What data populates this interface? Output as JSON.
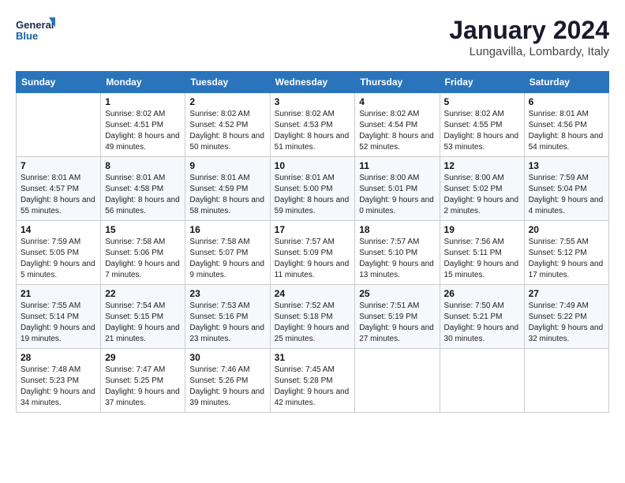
{
  "logo": {
    "line1": "General",
    "line2": "Blue"
  },
  "title": "January 2024",
  "subtitle": "Lungavilla, Lombardy, Italy",
  "days_header": [
    "Sunday",
    "Monday",
    "Tuesday",
    "Wednesday",
    "Thursday",
    "Friday",
    "Saturday"
  ],
  "weeks": [
    [
      {
        "num": "",
        "sunrise": "",
        "sunset": "",
        "daylight": ""
      },
      {
        "num": "1",
        "sunrise": "Sunrise: 8:02 AM",
        "sunset": "Sunset: 4:51 PM",
        "daylight": "Daylight: 8 hours and 49 minutes."
      },
      {
        "num": "2",
        "sunrise": "Sunrise: 8:02 AM",
        "sunset": "Sunset: 4:52 PM",
        "daylight": "Daylight: 8 hours and 50 minutes."
      },
      {
        "num": "3",
        "sunrise": "Sunrise: 8:02 AM",
        "sunset": "Sunset: 4:53 PM",
        "daylight": "Daylight: 8 hours and 51 minutes."
      },
      {
        "num": "4",
        "sunrise": "Sunrise: 8:02 AM",
        "sunset": "Sunset: 4:54 PM",
        "daylight": "Daylight: 8 hours and 52 minutes."
      },
      {
        "num": "5",
        "sunrise": "Sunrise: 8:02 AM",
        "sunset": "Sunset: 4:55 PM",
        "daylight": "Daylight: 8 hours and 53 minutes."
      },
      {
        "num": "6",
        "sunrise": "Sunrise: 8:01 AM",
        "sunset": "Sunset: 4:56 PM",
        "daylight": "Daylight: 8 hours and 54 minutes."
      }
    ],
    [
      {
        "num": "7",
        "sunrise": "Sunrise: 8:01 AM",
        "sunset": "Sunset: 4:57 PM",
        "daylight": "Daylight: 8 hours and 55 minutes."
      },
      {
        "num": "8",
        "sunrise": "Sunrise: 8:01 AM",
        "sunset": "Sunset: 4:58 PM",
        "daylight": "Daylight: 8 hours and 56 minutes."
      },
      {
        "num": "9",
        "sunrise": "Sunrise: 8:01 AM",
        "sunset": "Sunset: 4:59 PM",
        "daylight": "Daylight: 8 hours and 58 minutes."
      },
      {
        "num": "10",
        "sunrise": "Sunrise: 8:01 AM",
        "sunset": "Sunset: 5:00 PM",
        "daylight": "Daylight: 8 hours and 59 minutes."
      },
      {
        "num": "11",
        "sunrise": "Sunrise: 8:00 AM",
        "sunset": "Sunset: 5:01 PM",
        "daylight": "Daylight: 9 hours and 0 minutes."
      },
      {
        "num": "12",
        "sunrise": "Sunrise: 8:00 AM",
        "sunset": "Sunset: 5:02 PM",
        "daylight": "Daylight: 9 hours and 2 minutes."
      },
      {
        "num": "13",
        "sunrise": "Sunrise: 7:59 AM",
        "sunset": "Sunset: 5:04 PM",
        "daylight": "Daylight: 9 hours and 4 minutes."
      }
    ],
    [
      {
        "num": "14",
        "sunrise": "Sunrise: 7:59 AM",
        "sunset": "Sunset: 5:05 PM",
        "daylight": "Daylight: 9 hours and 5 minutes."
      },
      {
        "num": "15",
        "sunrise": "Sunrise: 7:58 AM",
        "sunset": "Sunset: 5:06 PM",
        "daylight": "Daylight: 9 hours and 7 minutes."
      },
      {
        "num": "16",
        "sunrise": "Sunrise: 7:58 AM",
        "sunset": "Sunset: 5:07 PM",
        "daylight": "Daylight: 9 hours and 9 minutes."
      },
      {
        "num": "17",
        "sunrise": "Sunrise: 7:57 AM",
        "sunset": "Sunset: 5:09 PM",
        "daylight": "Daylight: 9 hours and 11 minutes."
      },
      {
        "num": "18",
        "sunrise": "Sunrise: 7:57 AM",
        "sunset": "Sunset: 5:10 PM",
        "daylight": "Daylight: 9 hours and 13 minutes."
      },
      {
        "num": "19",
        "sunrise": "Sunrise: 7:56 AM",
        "sunset": "Sunset: 5:11 PM",
        "daylight": "Daylight: 9 hours and 15 minutes."
      },
      {
        "num": "20",
        "sunrise": "Sunrise: 7:55 AM",
        "sunset": "Sunset: 5:12 PM",
        "daylight": "Daylight: 9 hours and 17 minutes."
      }
    ],
    [
      {
        "num": "21",
        "sunrise": "Sunrise: 7:55 AM",
        "sunset": "Sunset: 5:14 PM",
        "daylight": "Daylight: 9 hours and 19 minutes."
      },
      {
        "num": "22",
        "sunrise": "Sunrise: 7:54 AM",
        "sunset": "Sunset: 5:15 PM",
        "daylight": "Daylight: 9 hours and 21 minutes."
      },
      {
        "num": "23",
        "sunrise": "Sunrise: 7:53 AM",
        "sunset": "Sunset: 5:16 PM",
        "daylight": "Daylight: 9 hours and 23 minutes."
      },
      {
        "num": "24",
        "sunrise": "Sunrise: 7:52 AM",
        "sunset": "Sunset: 5:18 PM",
        "daylight": "Daylight: 9 hours and 25 minutes."
      },
      {
        "num": "25",
        "sunrise": "Sunrise: 7:51 AM",
        "sunset": "Sunset: 5:19 PM",
        "daylight": "Daylight: 9 hours and 27 minutes."
      },
      {
        "num": "26",
        "sunrise": "Sunrise: 7:50 AM",
        "sunset": "Sunset: 5:21 PM",
        "daylight": "Daylight: 9 hours and 30 minutes."
      },
      {
        "num": "27",
        "sunrise": "Sunrise: 7:49 AM",
        "sunset": "Sunset: 5:22 PM",
        "daylight": "Daylight: 9 hours and 32 minutes."
      }
    ],
    [
      {
        "num": "28",
        "sunrise": "Sunrise: 7:48 AM",
        "sunset": "Sunset: 5:23 PM",
        "daylight": "Daylight: 9 hours and 34 minutes."
      },
      {
        "num": "29",
        "sunrise": "Sunrise: 7:47 AM",
        "sunset": "Sunset: 5:25 PM",
        "daylight": "Daylight: 9 hours and 37 minutes."
      },
      {
        "num": "30",
        "sunrise": "Sunrise: 7:46 AM",
        "sunset": "Sunset: 5:26 PM",
        "daylight": "Daylight: 9 hours and 39 minutes."
      },
      {
        "num": "31",
        "sunrise": "Sunrise: 7:45 AM",
        "sunset": "Sunset: 5:28 PM",
        "daylight": "Daylight: 9 hours and 42 minutes."
      },
      {
        "num": "",
        "sunrise": "",
        "sunset": "",
        "daylight": ""
      },
      {
        "num": "",
        "sunrise": "",
        "sunset": "",
        "daylight": ""
      },
      {
        "num": "",
        "sunrise": "",
        "sunset": "",
        "daylight": ""
      }
    ]
  ]
}
